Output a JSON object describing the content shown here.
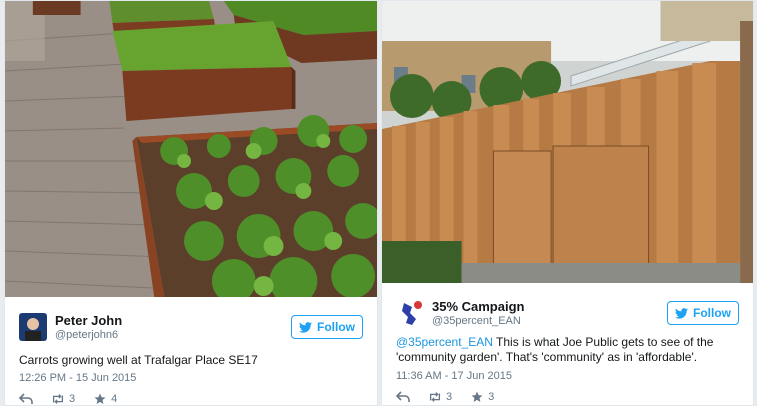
{
  "accent": "#1da1f2",
  "tweets": [
    {
      "author_name": "Peter John",
      "author_handle": "@peterjohn6",
      "follow_label": "Follow",
      "text": "Carrots growing well at Trafalgar Place SE17",
      "timestamp": "12:26 PM - 15 Jun 2015",
      "retweets": "3",
      "favorites": "4",
      "image": "raised-planter-beds-rooftop-garden"
    },
    {
      "author_name": "35% Campaign",
      "author_handle": "@35percent_EAN",
      "follow_label": "Follow",
      "text_mention": "@35percent_EAN",
      "text": " This is what Joe Public gets to see of the 'community garden'. That's 'community' as in 'affordable'.",
      "timestamp": "11:36 AM - 17 Jun 2015",
      "retweets": "3",
      "favorites": "3",
      "image": "wooden-fence-wall"
    }
  ]
}
